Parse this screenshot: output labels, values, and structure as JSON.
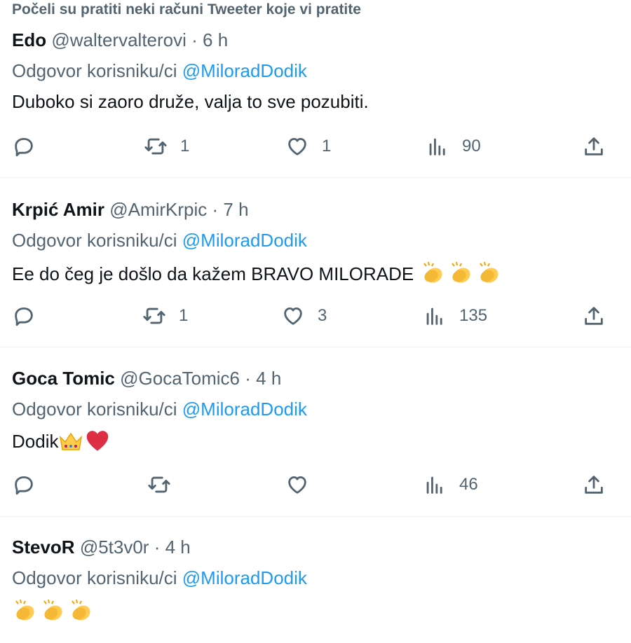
{
  "banner": "Počeli su pratiti neki računi Tweeter koje vi pratite",
  "reply_prefix": "Odgovor korisniku/ci",
  "colors": {
    "mention": "#1d9bf0",
    "muted": "#536471",
    "text": "#0f1419",
    "heart": "#e0245e"
  },
  "icons": [
    "reply-icon",
    "retweet-icon",
    "like-icon",
    "views-icon",
    "share-icon",
    "clap-emoji",
    "crown-emoji",
    "red-heart-emoji"
  ],
  "tweets": [
    {
      "name": "Edo",
      "handle": "@waltervalterovi",
      "time": "6 h",
      "mention": "@MiloradDodik",
      "text": "Duboko si zaoro druže, valja to sve pozubiti.",
      "retweets": "1",
      "likes": "1",
      "views": "90"
    },
    {
      "name": "Krpić Amir",
      "handle": "@AmirKrpic",
      "time": "7 h",
      "mention": "@MiloradDodik",
      "text": "Ee do čeg je došlo da kažem BRAVO MILORADE",
      "retweets": "1",
      "likes": "3",
      "views": "135"
    },
    {
      "name": "Goca Tomic",
      "handle": "@GocaTomic6",
      "time": "4 h",
      "mention": "@MiloradDodik",
      "text": "Dodik",
      "retweets": "",
      "likes": "",
      "views": "46"
    },
    {
      "name": "StevoR",
      "handle": "@5t3v0r",
      "time": "4 h",
      "mention": "@MiloradDodik",
      "text": ""
    }
  ]
}
